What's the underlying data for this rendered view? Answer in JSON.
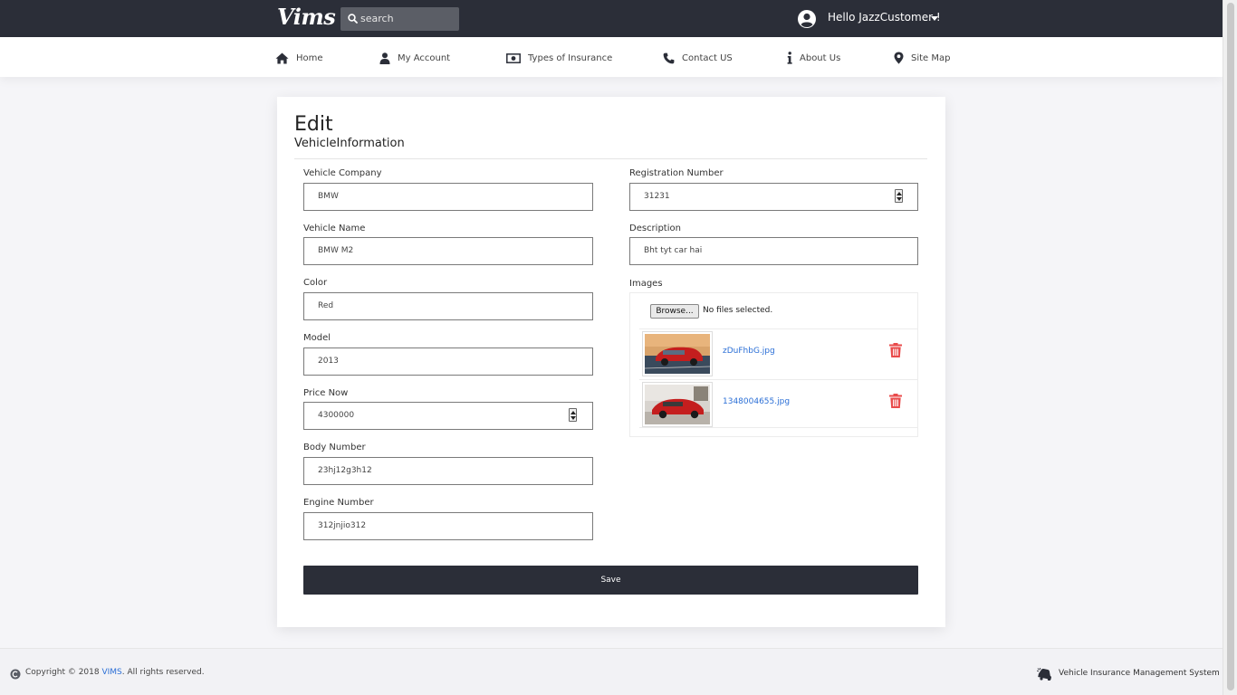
{
  "header": {
    "logo": "Vims",
    "search_placeholder": "search",
    "greeting": "Hello JazzCustomer !"
  },
  "nav": [
    {
      "label": "Home",
      "icon": "home-icon"
    },
    {
      "label": "My Account",
      "icon": "user-icon"
    },
    {
      "label": "Types of Insurance",
      "icon": "money-icon"
    },
    {
      "label": "Contact US",
      "icon": "phone-icon"
    },
    {
      "label": "About Us",
      "icon": "info-icon"
    },
    {
      "label": "Site Map",
      "icon": "map-marker-icon"
    }
  ],
  "form": {
    "title": "Edit",
    "subtitle": "VehicleInformation",
    "left_fields": [
      {
        "label": "Vehicle Company",
        "value": "BMW"
      },
      {
        "label": "Vehicle Name",
        "value": "BMW M2"
      },
      {
        "label": "Color",
        "value": "Red"
      },
      {
        "label": "Model",
        "value": "2013"
      },
      {
        "label": "Price Now",
        "value": "4300000"
      },
      {
        "label": "Body Number",
        "value": "23hj12g3h12"
      },
      {
        "label": "Engine Number",
        "value": "312jnjio312"
      }
    ],
    "right_fields": [
      {
        "label": "Registration Number",
        "value": "31231"
      },
      {
        "label": "Description",
        "value": "Bht tyt car hai"
      }
    ],
    "images_label": "Images",
    "browse_label": "Browse...",
    "no_files_text": "No files selected.",
    "images": [
      {
        "filename": "zDuFhbG.jpg"
      },
      {
        "filename": "1348004655.jpg"
      }
    ],
    "save_label": "Save"
  },
  "footer": {
    "copyright_prefix": "Copyright © 2018",
    "brand": "VIMS",
    "copyright_suffix": ". All rights reserved.",
    "system_name": "Vehicle Insurance Management System"
  },
  "colors": {
    "dark": "#2b2e38",
    "link": "#2b6fd6",
    "danger": "#e94b4b",
    "background": "#f5f5f8"
  }
}
